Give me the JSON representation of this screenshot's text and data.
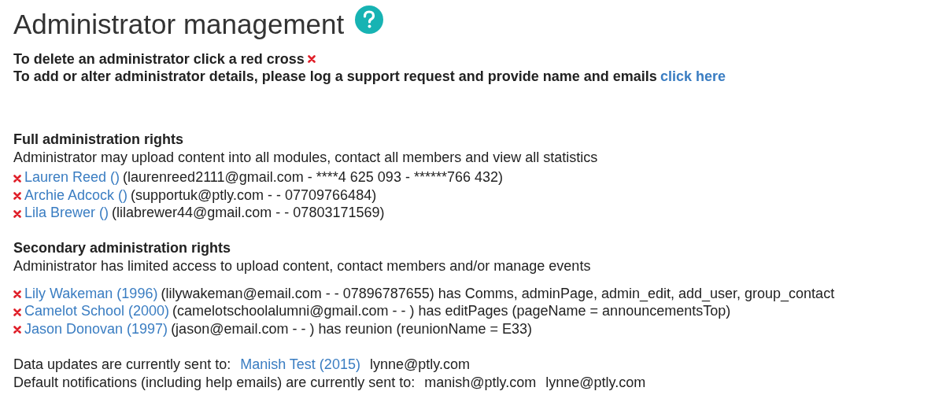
{
  "title": "Administrator management",
  "instructions": {
    "delete_text": "To delete an administrator click a red cross",
    "alter_text": "To add or alter administrator details, please log a support request and provide name and emails",
    "alter_link": "click here"
  },
  "sections": [
    {
      "heading": "Full administration rights",
      "description": "Administrator may upload content into all modules, contact all members and view all statistics",
      "admins": [
        {
          "name": "Lauren Reed ()",
          "details": "(laurenreed2111@gmail.com - ****4 625 093 - ******766 432)"
        },
        {
          "name": "Archie Adcock ()",
          "details": "(supportuk@ptly.com - - 07709766484)"
        },
        {
          "name": "Lila Brewer ()",
          "details": "(lilabrewer44@gmail.com - - 07803171569)"
        }
      ]
    },
    {
      "heading": "Secondary administration rights",
      "description": "Administrator has limited access to upload content, contact members and/or manage events",
      "admins": [
        {
          "name": "Lily Wakeman (1996)",
          "details": "(lilywakeman@email.com - - 07896787655) has Comms, adminPage, admin_edit, add_user, group_contact"
        },
        {
          "name": "Camelot School (2000)",
          "details": "(camelotschoolalumni@gmail.com - - ) has editPages (pageName = announcementsTop)"
        },
        {
          "name": "Jason Donovan (1997)",
          "details": "(jason@email.com - - ) has reunion (reunionName = E33)"
        }
      ]
    }
  ],
  "footer": [
    {
      "parts": [
        {
          "kind": "text",
          "text": "Data updates are currently sent to:"
        },
        {
          "kind": "link",
          "text": "Manish Test (2015)"
        },
        {
          "kind": "text",
          "text": "lynne@ptly.com"
        }
      ]
    },
    {
      "parts": [
        {
          "kind": "text",
          "text": "Default notifications (including help emails) are currently sent to:"
        },
        {
          "kind": "text",
          "text": "manish@ptly.com"
        },
        {
          "kind": "text",
          "text": "lynne@ptly.com"
        }
      ]
    }
  ]
}
